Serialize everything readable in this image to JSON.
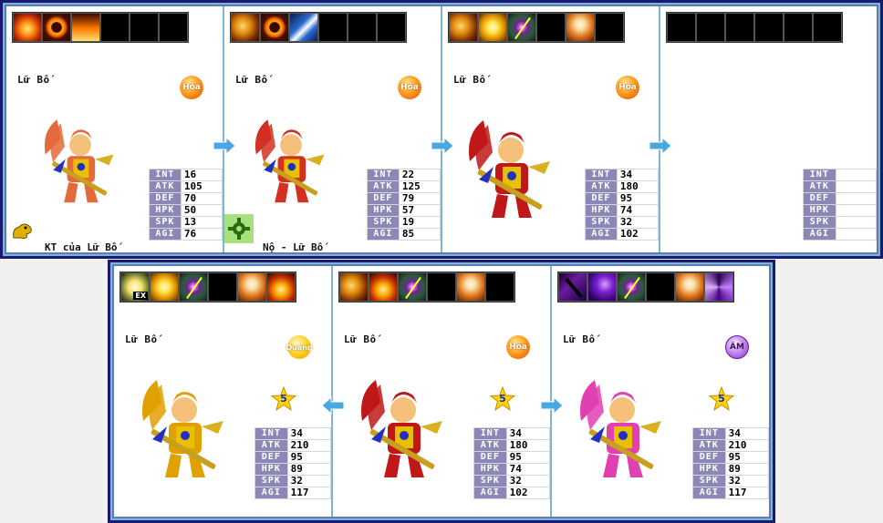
{
  "top_row": [
    {
      "name": "Lữ Bố",
      "element": "Hỏa",
      "element_icon": "fire-element-icon",
      "skills": [
        "fire-skill-icon",
        "fire-ring-skill-icon",
        "blaze-skill-icon",
        "",
        "",
        ""
      ],
      "stats": {
        "INT": "16",
        "ATK": "105",
        "DEF": "70",
        "HPK": "50",
        "SPK": "13",
        "AGI": "76"
      },
      "caption": "KT của Lữ Bố",
      "caption_icon": "gold-dragon-icon",
      "hero_color": "#e36a3a"
    },
    {
      "name": "Lữ Bố",
      "element": "Hỏa",
      "element_icon": "fire-element-icon",
      "skills": [
        "dragon-skill-icon",
        "fire-ring-skill-icon",
        "spear-skill-icon",
        "",
        "",
        ""
      ],
      "stats": {
        "INT": "22",
        "ATK": "125",
        "DEF": "79",
        "HPK": "57",
        "SPK": "19",
        "AGI": "85"
      },
      "caption": "Nộ - Lữ Bố",
      "caption_icon": "green-gear-icon",
      "hero_color": "#d23020"
    },
    {
      "name": "Lữ Bố",
      "element": "Hỏa",
      "element_icon": "fire-element-icon",
      "skills": [
        "dragon-skill-icon",
        "gold-flame-skill-icon",
        "aim-skill-icon",
        "",
        "angel-skill-icon",
        ""
      ],
      "stats": {
        "INT": "34",
        "ATK": "180",
        "DEF": "95",
        "HPK": "74",
        "SPK": "32",
        "AGI": "102"
      },
      "caption": "",
      "caption_icon": "",
      "hero_color": "#c01818"
    },
    {
      "name": "",
      "element": "",
      "element_icon": "",
      "skills": [
        "",
        "",
        "",
        "",
        "",
        "",
        ""
      ],
      "stats": {
        "INT": "",
        "ATK": "",
        "DEF": "",
        "HPK": "",
        "SPK": "",
        "AGI": ""
      },
      "caption": "",
      "caption_icon": "",
      "hero_color": ""
    }
  ],
  "bottom_row": [
    {
      "name": "Lữ Bố",
      "element": "Quang",
      "element_icon": "light-element-icon",
      "skills": [
        "ex-skill-icon",
        "gold-flame-skill-icon",
        "aim-skill-icon",
        "",
        "angel-skill-icon",
        "flame-skill-icon"
      ],
      "stats": {
        "INT": "34",
        "ATK": "210",
        "DEF": "95",
        "HPK": "89",
        "SPK": "32",
        "AGI": "117"
      },
      "star": "5",
      "hero_color": "#e0a000"
    },
    {
      "name": "Lữ Bố",
      "element": "Hỏa",
      "element_icon": "fire-element-icon",
      "skills": [
        "dragon-skill-icon",
        "flame-skill-icon",
        "aim-skill-icon",
        "",
        "angel-skill-icon",
        ""
      ],
      "stats": {
        "INT": "34",
        "ATK": "180",
        "DEF": "95",
        "HPK": "74",
        "SPK": "32",
        "AGI": "102"
      },
      "star": "5",
      "hero_color": "#c01818"
    },
    {
      "name": "Lữ Bố",
      "element": "ÂM",
      "element_icon": "dark-element-icon",
      "skills": [
        "dagger-skill-icon",
        "swirl-skill-icon",
        "aim-skill-icon",
        "",
        "angel-skill-icon",
        "vortex-skill-icon"
      ],
      "stats": {
        "INT": "34",
        "ATK": "210",
        "DEF": "95",
        "HPK": "89",
        "SPK": "32",
        "AGI": "117"
      },
      "star": "5",
      "hero_color": "#e040b0"
    }
  ],
  "stat_keys": [
    "INT",
    "ATK",
    "DEF",
    "HPK",
    "SPK",
    "AGI"
  ],
  "colors": {
    "frame": "#1a1a6e",
    "divider": "#7fb4d8",
    "stat_key_bg": "#8b88b8",
    "arrow": "#4aa8e0"
  }
}
